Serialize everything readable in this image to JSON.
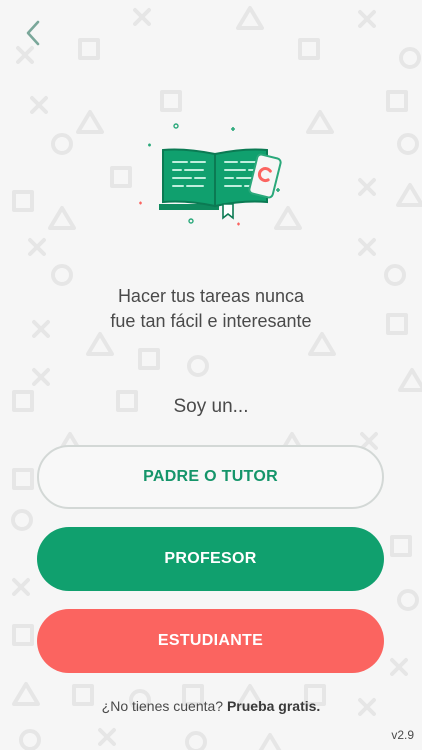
{
  "nav": {
    "back_icon": "chevron-left-icon"
  },
  "hero": {
    "illustration": "open-book-and-phone-icon"
  },
  "tagline": {
    "line1": "Hacer tus tareas nunca",
    "line2": "fue tan fácil e interesante"
  },
  "prompt": "Soy un...",
  "buttons": {
    "parent": "PADRE O TUTOR",
    "teacher": "PROFESOR",
    "student": "ESTUDIANTE"
  },
  "footer": {
    "question": "¿No tienes cuenta?",
    "link": "Prueba gratis."
  },
  "version": "v2.9",
  "colors": {
    "brand_green": "#10a06e",
    "student_red": "#fb6460",
    "background": "#f6f6f6"
  }
}
